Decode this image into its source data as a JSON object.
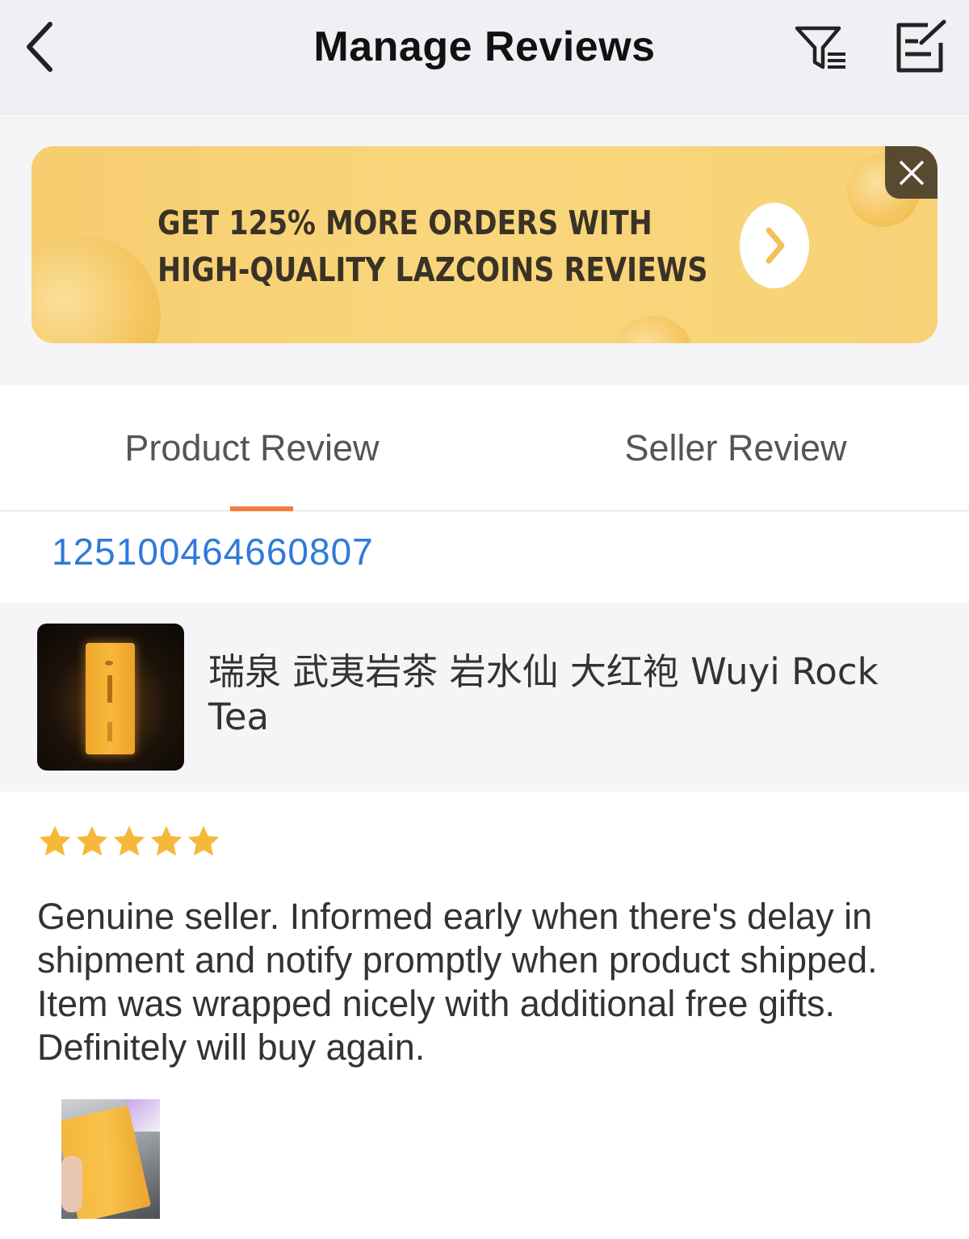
{
  "header": {
    "title": "Manage Reviews",
    "back_icon": "chevron-left-icon",
    "filter_icon": "filter-icon",
    "edit_icon": "edit-note-icon"
  },
  "banner": {
    "line1": "GET 125% MORE ORDERS WITH",
    "line2": "HIGH-QUALITY LAZCOINS REVIEWS",
    "arrow_icon": "chevron-right-icon",
    "close_icon": "close-icon",
    "background_color": "#f8d277"
  },
  "tabs": [
    {
      "label": "Product Review",
      "active": true
    },
    {
      "label": "Seller Review",
      "active": false
    }
  ],
  "accent_color": "#f27e3f",
  "order": {
    "id": "125100464660807",
    "color": "#2f7adb"
  },
  "product": {
    "name": "瑞泉 武夷岩茶 岩水仙 大红袍 Wuyi Rock Tea"
  },
  "review": {
    "rating": 5,
    "max_rating": 5,
    "star_color": "#f6b839",
    "text": "Genuine seller. Informed early when there's delay in shipment and notify promptly when product shipped. Item was wrapped nicely with additional free gifts. Definitely will buy again."
  }
}
